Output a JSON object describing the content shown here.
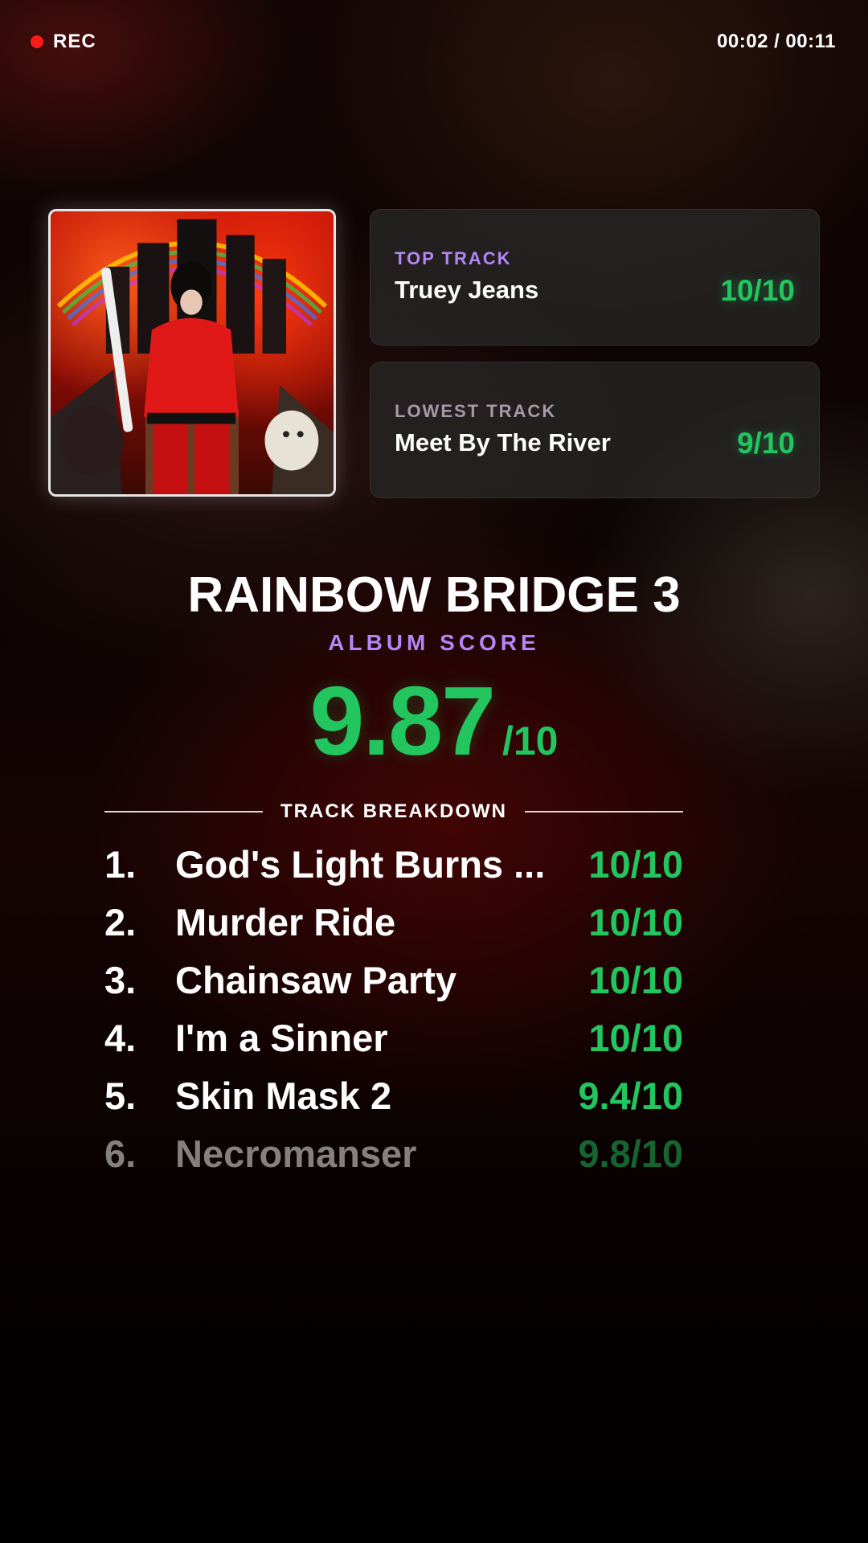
{
  "status": {
    "rec_label": "REC",
    "timer": "00:02 / 00:11"
  },
  "top_track": {
    "label": "TOP TRACK",
    "title": "Truey Jeans",
    "score": "10/10"
  },
  "lowest_track": {
    "label": "LOWEST TRACK",
    "title": "Meet By The River",
    "score": "9/10"
  },
  "album": {
    "title": "RAINBOW BRIDGE 3",
    "score_label": "ALBUM SCORE",
    "score": "9.87",
    "score_out_of": "/10"
  },
  "breakdown": {
    "label": "TRACK BREAKDOWN",
    "tracks": [
      {
        "num": "1.",
        "name": "God's Light Burns ...",
        "score": "10/10"
      },
      {
        "num": "2.",
        "name": "Murder Ride",
        "score": "10/10"
      },
      {
        "num": "3.",
        "name": "Chainsaw Party",
        "score": "10/10"
      },
      {
        "num": "4.",
        "name": "I'm a Sinner",
        "score": "10/10"
      },
      {
        "num": "5.",
        "name": "Skin Mask 2",
        "score": "9.4/10"
      },
      {
        "num": "6.",
        "name": "Necromanser",
        "score": "9.8/10"
      }
    ]
  },
  "colors": {
    "accent_purple": "#b486f5",
    "score_green": "#22c55e",
    "rec_red": "#ff1a1a"
  }
}
